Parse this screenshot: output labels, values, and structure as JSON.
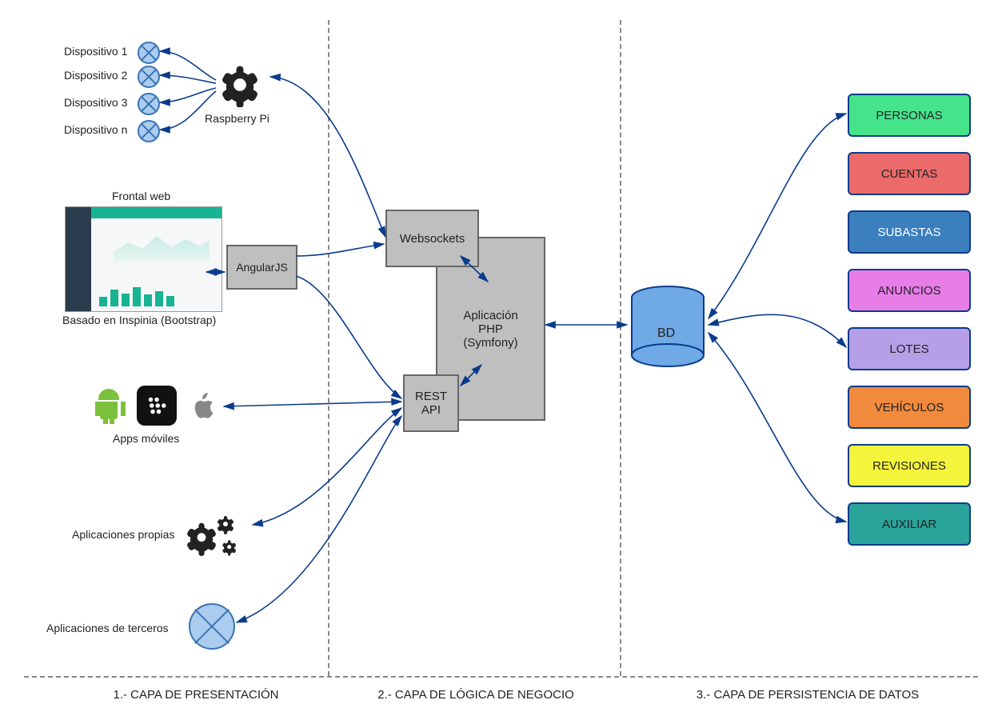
{
  "layers": {
    "presentation": "1.- CAPA DE PRESENTACIÓN",
    "logic": "2.- CAPA DE LÓGICA DE NEGOCIO",
    "persistence": "3.- CAPA DE PERSISTENCIA DE DATOS"
  },
  "devices": {
    "d1": "Dispositivo 1",
    "d2": "Dispositivo 2",
    "d3": "Dispositivo 3",
    "dn": "Dispositivo n"
  },
  "raspberry": "Raspberry Pi",
  "frontal_web": "Frontal web",
  "inspinia": "Basado en Inspinia (Bootstrap)",
  "angular": "AngularJS",
  "apps_moviles": "Apps móviles",
  "aplicaciones_propias": "Aplicaciones propias",
  "aplicaciones_terceros": "Aplicaciones de terceros",
  "websockets": "Websockets",
  "app_php": "Aplicación\nPHP\n(Symfony)",
  "rest_api": "REST\nAPI",
  "bd": "BD",
  "db_tables": {
    "personas": {
      "label": "PERSONAS",
      "color": "#45e48b"
    },
    "cuentas": {
      "label": "CUENTAS",
      "color": "#eb6a6a"
    },
    "subastas": {
      "label": "SUBASTAS",
      "color": "#3b7fbf"
    },
    "anuncios": {
      "label": "ANUNCIOS",
      "color": "#e87de8"
    },
    "lotes": {
      "label": "LOTES",
      "color": "#b79fe8"
    },
    "vehiculos": {
      "label": "VEHÍCULOS",
      "color": "#f08a3c"
    },
    "revisiones": {
      "label": "REVISIONES",
      "color": "#f4f43c"
    },
    "auxiliar": {
      "label": "AUXILIAR",
      "color": "#2aa39a"
    }
  }
}
